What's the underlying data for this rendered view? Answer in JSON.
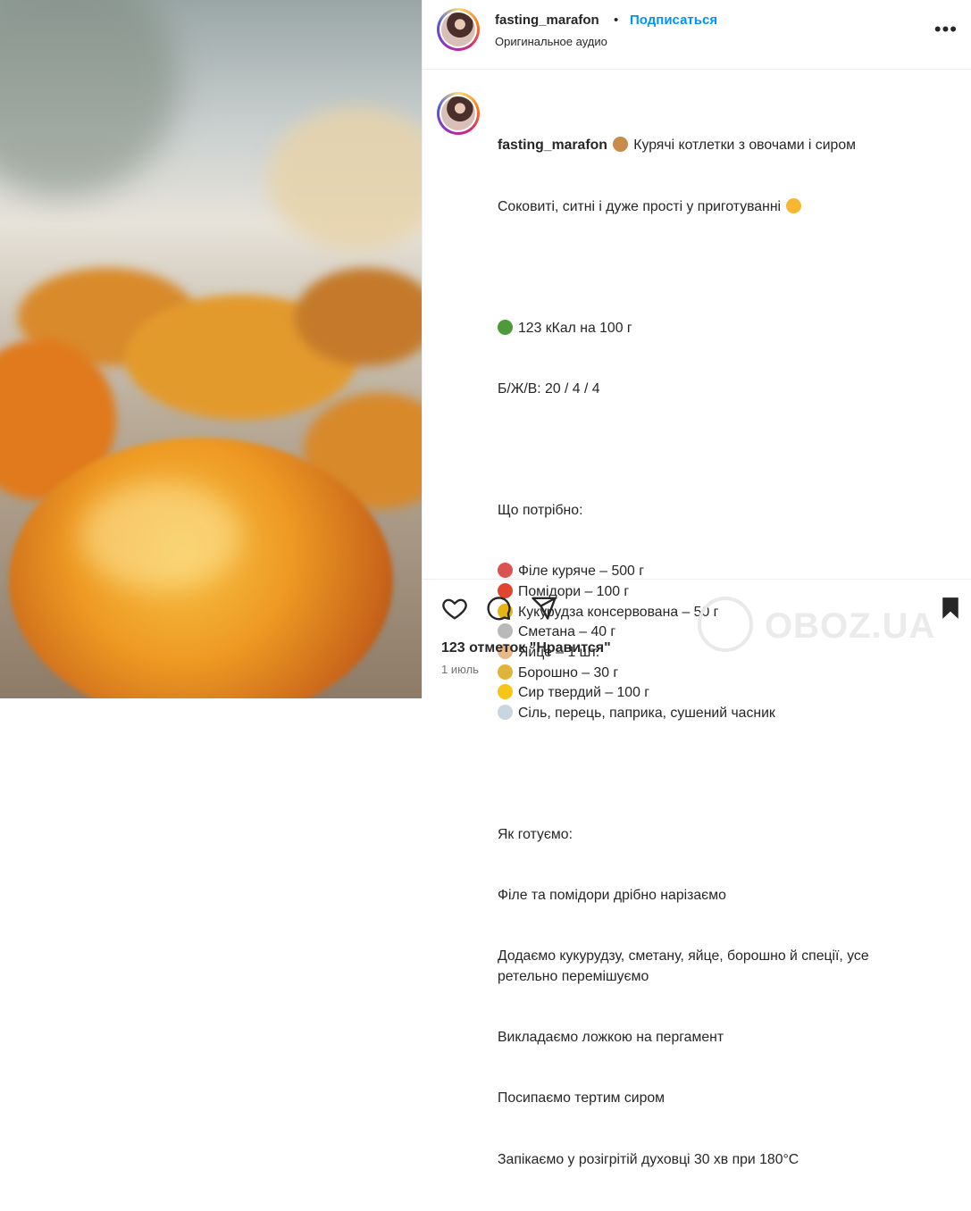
{
  "post": {
    "username": "fasting_marafon",
    "follow_label": "Подписаться",
    "audio_label": "Оригинальное аудио",
    "more_label": "•••"
  },
  "caption": {
    "username": "fasting_marafon",
    "title": "Курячі котлетки з овочами і сиром",
    "subtitle": "Соковиті, ситні і дуже прості у приготуванні",
    "kcal": "123 кКал на 100 г",
    "bju": "Б/Ж/В: 20 / 4 / 4",
    "ingredients_heading": "Що потрібно:",
    "ingredients": [
      {
        "icon": "meat-emoji-icon",
        "color": "#d9534f",
        "text": "Філе куряче – 500 г"
      },
      {
        "icon": "tomato-emoji-icon",
        "color": "#e2452f",
        "text": "Помідори – 100 г"
      },
      {
        "icon": "corn-emoji-icon",
        "color": "#e7b416",
        "text": "Кукурудза консервована – 50 г"
      },
      {
        "icon": "spoon-emoji-icon",
        "color": "#b9b9b9",
        "text": "Сметана – 40 г"
      },
      {
        "icon": "egg-emoji-icon",
        "color": "#e5b98a",
        "text": "Яйце – 1 шт."
      },
      {
        "icon": "wheat-emoji-icon",
        "color": "#e0b43a",
        "text": "Борошно – 30 г"
      },
      {
        "icon": "cheese-emoji-icon",
        "color": "#f5c518",
        "text": "Сир твердий – 100 г"
      },
      {
        "icon": "salt-emoji-icon",
        "color": "#c9d6df",
        "text": "Сіль, перець, паприка, сушений часник"
      }
    ],
    "steps_heading": "Як готуємо:",
    "steps": [
      "Філе та помідори дрібно нарізаємо",
      "Додаємо кукурудзу, сметану, яйце, борошно й спеції, усе ретельно перемішуємо",
      "Викладаємо ложкою на пергамент",
      "Посипаємо тертим сиром",
      "Запікаємо у розігрітій духовці 30 хв при 180°С"
    ]
  },
  "footer": {
    "likes": "123 отметок \"Нравится\"",
    "date": "1 июль",
    "watermark": "OBOZ.UA"
  },
  "colors": {
    "accent": "#0095f6",
    "text": "#262626",
    "muted": "#737373"
  }
}
